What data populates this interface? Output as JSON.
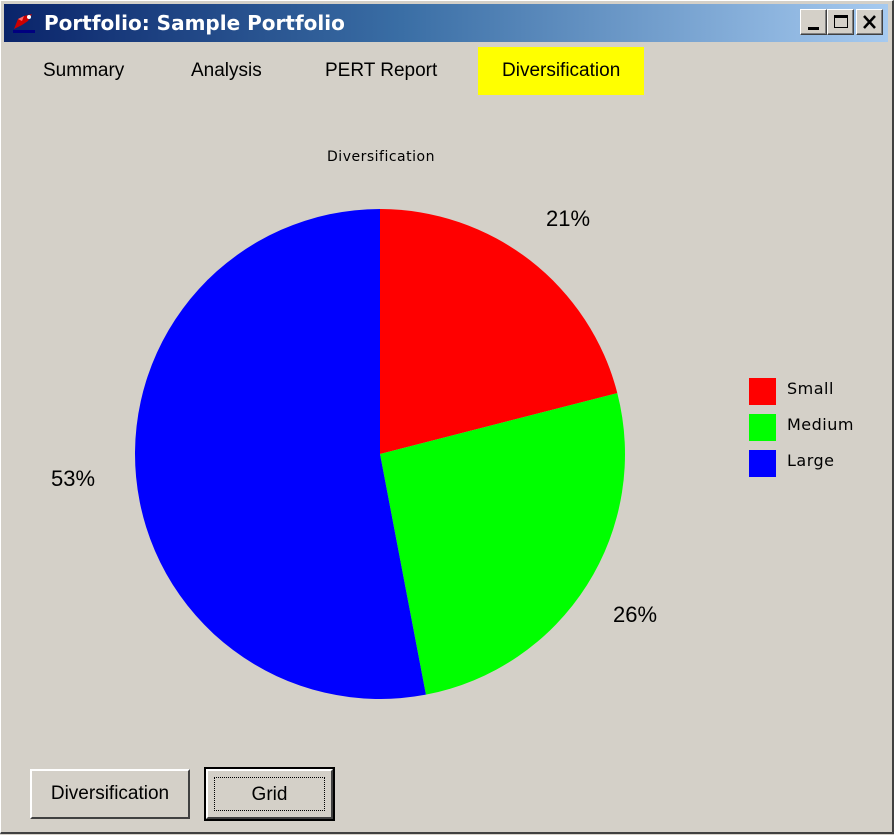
{
  "window": {
    "title": "Portfolio: Sample Portfolio",
    "controls": [
      "minimize",
      "maximize",
      "close"
    ]
  },
  "tabs": [
    {
      "label": "Summary",
      "active": false
    },
    {
      "label": "Analysis",
      "active": false
    },
    {
      "label": "PERT Report",
      "active": false
    },
    {
      "label": "Diversification",
      "active": true
    }
  ],
  "chart_data": {
    "type": "pie",
    "title": "Diversification",
    "categories": [
      "Small",
      "Medium",
      "Large"
    ],
    "values": [
      21,
      26,
      53
    ],
    "value_labels": [
      "21%",
      "26%",
      "53%"
    ],
    "colors": [
      "#ff0000",
      "#00ff00",
      "#0000ff"
    ],
    "legend_position": "right"
  },
  "buttons": {
    "diversification": "Diversification",
    "grid": "Grid"
  },
  "colors": {
    "active_tab": "#ffff00",
    "background": "#d4d0c8"
  }
}
